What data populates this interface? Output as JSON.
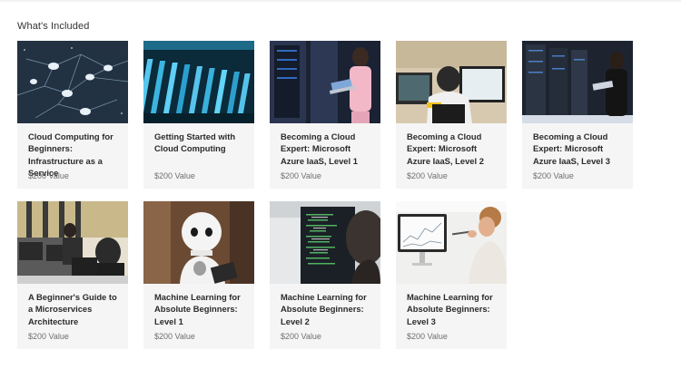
{
  "section": {
    "title": "What's Included"
  },
  "courses": [
    {
      "title": "Cloud Computing for Beginners: Infrastructure as a Service",
      "value": "$200 Value",
      "thumb": "cloud-network-thumbnail"
    },
    {
      "title": "Getting Started with Cloud Computing",
      "value": "$200 Value",
      "thumb": "server-cables-thumbnail"
    },
    {
      "title": "Becoming a Cloud Expert: Microsoft Azure IaaS, Level 1",
      "value": "$200 Value",
      "thumb": "datacenter-laptop-thumbnail"
    },
    {
      "title": "Becoming a Cloud Expert: Microsoft Azure IaaS, Level 2",
      "value": "$200 Value",
      "thumb": "developer-monitors-thumbnail"
    },
    {
      "title": "Becoming a Cloud Expert: Microsoft Azure IaaS, Level 3",
      "value": "$200 Value",
      "thumb": "server-room-laptop-thumbnail"
    },
    {
      "title": "A Beginner's Guide to a Microservices Architecture",
      "value": "$200 Value",
      "thumb": "office-workstations-thumbnail"
    },
    {
      "title": "Machine Learning for Absolute Beginners: Level 1",
      "value": "$200 Value",
      "thumb": "humanoid-robot-thumbnail"
    },
    {
      "title": "Machine Learning for Absolute Beginners: Level 2",
      "value": "$200 Value",
      "thumb": "code-screen-thumbnail"
    },
    {
      "title": "Machine Learning for Absolute Beginners: Level 3",
      "value": "$200 Value",
      "thumb": "scientist-monitor-thumbnail"
    }
  ]
}
